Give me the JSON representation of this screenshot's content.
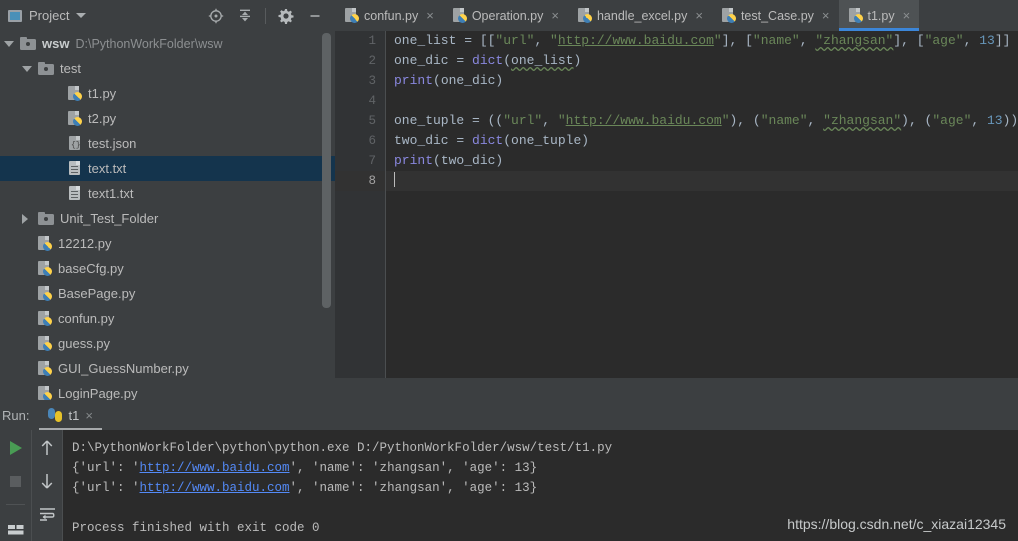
{
  "toolbar": {
    "project_label": "Project",
    "icons": [
      "locate-icon",
      "collapse-all-icon",
      "settings-gear-icon",
      "minimize-icon"
    ]
  },
  "tabs": [
    {
      "label": "confun.py",
      "active": false,
      "close": "×"
    },
    {
      "label": "Operation.py",
      "active": false,
      "close": "×"
    },
    {
      "label": "handle_excel.py",
      "active": false,
      "close": "×"
    },
    {
      "label": "test_Case.py",
      "active": false,
      "close": "×"
    },
    {
      "label": "t1.py",
      "active": true,
      "close": "×"
    }
  ],
  "tree": {
    "root": {
      "name": "wsw",
      "path": "D:\\PythonWorkFolder\\wsw"
    },
    "items": [
      {
        "label": "test",
        "type": "folder",
        "expanded": true,
        "indent": 1
      },
      {
        "label": "t1.py",
        "type": "py",
        "indent": 2
      },
      {
        "label": "t2.py",
        "type": "py",
        "indent": 2
      },
      {
        "label": "test.json",
        "type": "json",
        "indent": 2
      },
      {
        "label": "text.txt",
        "type": "txt",
        "indent": 2,
        "selected": true
      },
      {
        "label": "text1.txt",
        "type": "txt",
        "indent": 2
      },
      {
        "label": "Unit_Test_Folder",
        "type": "folder",
        "expanded": false,
        "indent": 1
      },
      {
        "label": "12212.py",
        "type": "py",
        "indent": 1
      },
      {
        "label": "baseCfg.py",
        "type": "py",
        "indent": 1
      },
      {
        "label": "BasePage.py",
        "type": "py",
        "indent": 1
      },
      {
        "label": "confun.py",
        "type": "py",
        "indent": 1
      },
      {
        "label": "guess.py",
        "type": "py",
        "indent": 1
      },
      {
        "label": "GUI_GuessNumber.py",
        "type": "py",
        "indent": 1
      },
      {
        "label": "LoginPage.py",
        "type": "py",
        "indent": 1
      }
    ]
  },
  "editor": {
    "line_numbers": [
      "1",
      "2",
      "3",
      "4",
      "5",
      "6",
      "7",
      "8"
    ],
    "current_line": 8,
    "lines": [
      "one_list = [[\"url\", \"http://www.baidu.com\"], [\"name\", \"zhangsan\"], [\"age\", 13]]",
      "one_dic = dict(one_list)",
      "print(one_dic)",
      "",
      "one_tuple = ((\"url\", \"http://www.baidu.com\"), (\"name\", \"zhangsan\"), (\"age\", 13))",
      "two_dic = dict(one_tuple)",
      "print(two_dic)",
      ""
    ]
  },
  "run": {
    "label": "Run:",
    "tab_name": "t1",
    "tab_close": "×",
    "buttons": [
      "run-icon",
      "stop-icon",
      "layout-icon",
      "scroll-up-icon",
      "scroll-down-icon",
      "soft-wrap-icon"
    ],
    "console": {
      "command": "D:\\PythonWorkFolder\\python\\python.exe D:/PythonWorkFolder/wsw/test/t1.py",
      "line1_pre": "{'url': '",
      "line1_url": "http://www.baidu.com",
      "line1_post": "', 'name': 'zhangsan', 'age': 13}",
      "line2_pre": "{'url': '",
      "line2_url": "http://www.baidu.com",
      "line2_post": "', 'name': 'zhangsan', 'age': 13}",
      "exit": "Process finished with exit code 0"
    }
  },
  "watermark": "https://blog.csdn.net/c_xiazai12345",
  "colors": {
    "bg_panel": "#3c3f41",
    "bg_editor": "#2b2b2b",
    "accent_tab": "#3c86d8",
    "selection": "#14344d",
    "string": "#6a8759",
    "keyword": "#8a88df",
    "number": "#6897bb",
    "link": "#548af7",
    "run_green": "#499c54"
  }
}
